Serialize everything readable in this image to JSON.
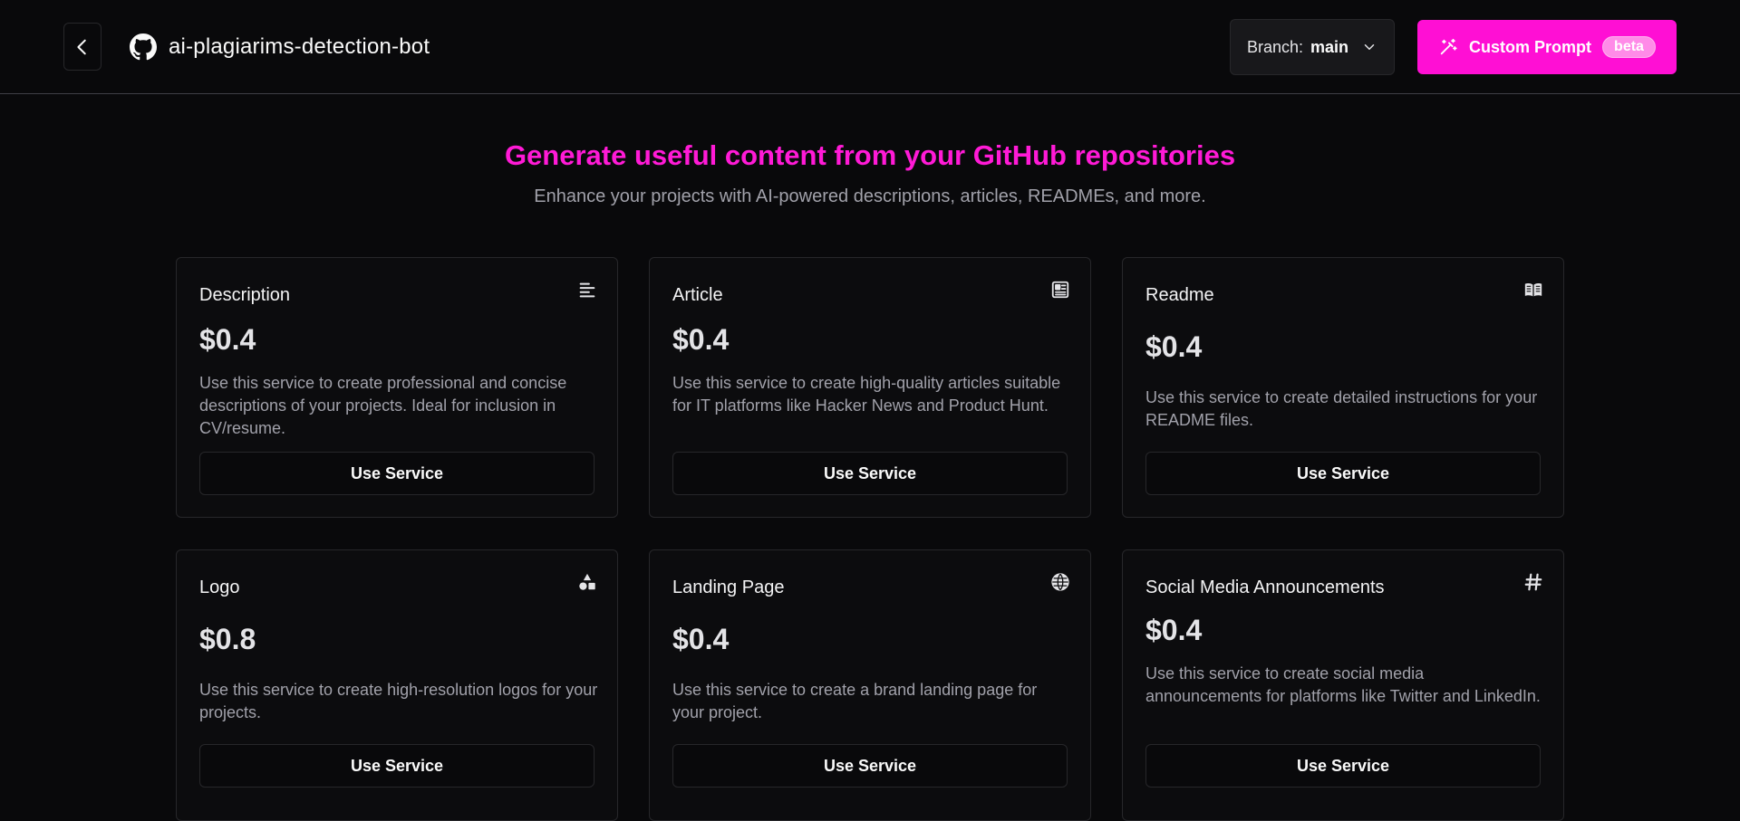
{
  "header": {
    "repo_name": "ai-plagiarims-detection-bot",
    "branch_label": "Branch:",
    "branch_value": "main",
    "custom_prompt_label": "Custom Prompt",
    "beta_label": "beta",
    "accent_color": "#ff0fd4"
  },
  "hero": {
    "title": "Generate useful content from your GitHub repositories",
    "subtitle": "Enhance your projects with AI-powered descriptions, articles, READMEs, and more."
  },
  "services": [
    {
      "title": "Description",
      "price": "$0.4",
      "icon": "align-left-icon",
      "description": "Use this service to create professional and concise descriptions of your projects. Ideal for inclusion in CV/resume.",
      "button": "Use Service"
    },
    {
      "title": "Article",
      "price": "$0.4",
      "icon": "newspaper-icon",
      "description": "Use this service to create high-quality articles suitable for IT platforms like Hacker News and Product Hunt.",
      "button": "Use Service"
    },
    {
      "title": "Readme",
      "price": "$0.4",
      "icon": "book-open-icon",
      "description": "Use this service to create detailed instructions for your README files.",
      "button": "Use Service"
    },
    {
      "title": "Logo",
      "price": "$0.8",
      "icon": "shapes-icon",
      "description": "Use this service to create high-resolution logos for your projects.",
      "button": "Use Service"
    },
    {
      "title": "Landing Page",
      "price": "$0.4",
      "icon": "globe-icon",
      "description": "Use this service to create a brand landing page for your project.",
      "button": "Use Service"
    },
    {
      "title": "Social Media Announcements",
      "price": "$0.4",
      "icon": "hash-icon",
      "description": "Use this service to create social media announcements for platforms like Twitter and LinkedIn.",
      "button": "Use Service"
    }
  ]
}
